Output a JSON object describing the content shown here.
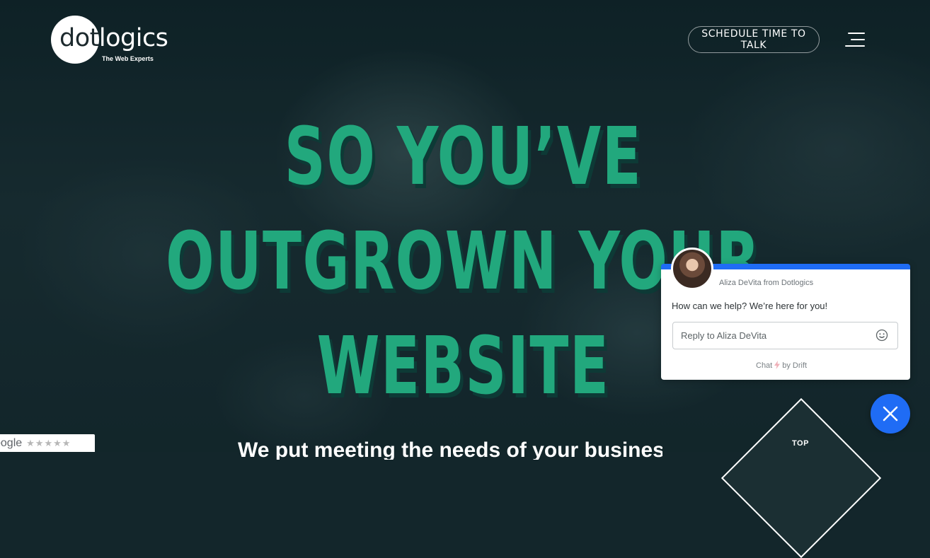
{
  "header": {
    "logo_dot": "dot",
    "logo_rest": "logics",
    "logo_tagline": "The Web Experts",
    "cta_label": "SCHEDULE TIME TO TALK",
    "menu_icon": "hamburger-menu-icon"
  },
  "hero": {
    "headline_lines": [
      "SO YOU’VE",
      "OUTGROWN YOUR",
      "WEBSITE"
    ],
    "subhead": "We put meeting the needs of your business",
    "accent_color": "#22a87d"
  },
  "google_badge": {
    "label": "oogle",
    "stars": "★★★★★"
  },
  "top_badge": {
    "label": "TOP"
  },
  "chat": {
    "from": "Aliza DeVita from Dotlogics",
    "message": "How can we help? We’re here for you!",
    "input_placeholder": "Reply to Aliza DeVita",
    "footer_chat": "Chat",
    "footer_by": "by Drift",
    "accent_color": "#1f6cf5"
  }
}
